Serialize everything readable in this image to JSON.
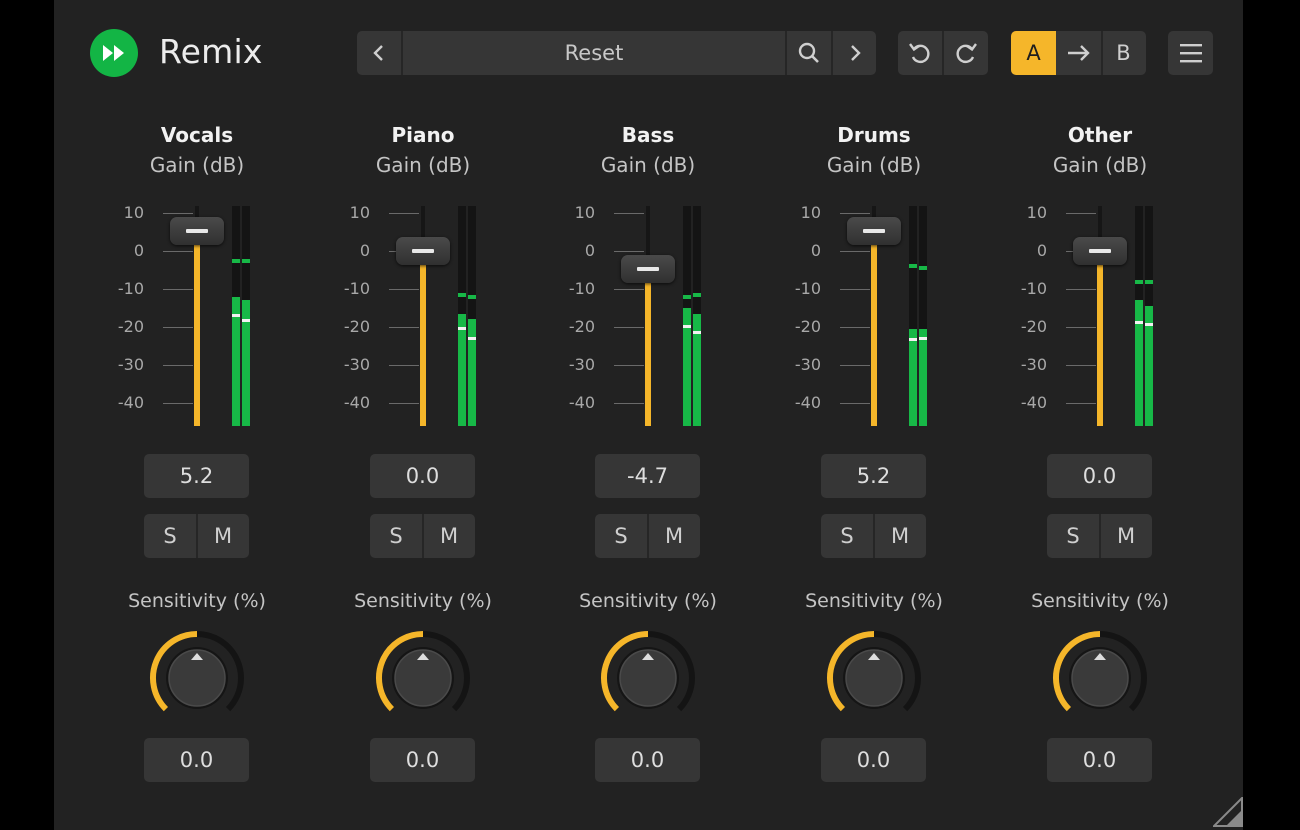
{
  "app": {
    "title": "Remix",
    "logo_icon": "fast-forward-icon",
    "accent": "#f5b62a",
    "logo_color": "#13b545",
    "meter_color": "#17b847"
  },
  "toolbar": {
    "prev_icon": "chevron-left-icon",
    "preset_name": "Reset",
    "search_icon": "search-icon",
    "next_icon": "chevron-right-icon",
    "undo_icon": "undo-icon",
    "redo_icon": "redo-icon",
    "ab_a_label": "A",
    "ab_copy_icon": "arrow-right-icon",
    "ab_b_label": "B",
    "menu_icon": "hamburger-menu-icon"
  },
  "scale_ticks": [
    "10",
    "0",
    "-10",
    "-20",
    "-30",
    "-40"
  ],
  "gain_label": "Gain (dB)",
  "sensitivity_label": "Sensitivity (%)",
  "solo_label": "S",
  "mute_label": "M",
  "channels": [
    {
      "name": "Vocals",
      "gain": "5.2",
      "gain_value": 5.2,
      "sensitivity": "0.0",
      "sensitivity_value": 0.0,
      "meter_left": {
        "peak": -2,
        "level": -12,
        "rms": -16.5
      },
      "meter_right": {
        "peak": -2,
        "level": -13,
        "rms": -18
      }
    },
    {
      "name": "Piano",
      "gain": "0.0",
      "gain_value": 0.0,
      "sensitivity": "0.0",
      "sensitivity_value": 0.0,
      "meter_left": {
        "peak": -11,
        "level": -16.5,
        "rms": -20
      },
      "meter_right": {
        "peak": -11.5,
        "level": -18,
        "rms": -22.5
      }
    },
    {
      "name": "Bass",
      "gain": "-4.7",
      "gain_value": -4.7,
      "sensitivity": "0.0",
      "sensitivity_value": 0.0,
      "meter_left": {
        "peak": -11.5,
        "level": -15,
        "rms": -19.5
      },
      "meter_right": {
        "peak": -11,
        "level": -16.5,
        "rms": -21
      }
    },
    {
      "name": "Drums",
      "gain": "5.2",
      "gain_value": 5.2,
      "sensitivity": "0.0",
      "sensitivity_value": 0.0,
      "meter_left": {
        "peak": -3.5,
        "level": -20.5,
        "rms": -23
      },
      "meter_right": {
        "peak": -4,
        "level": -20.5,
        "rms": -22.5
      }
    },
    {
      "name": "Other",
      "gain": "0.0",
      "gain_value": 0.0,
      "sensitivity": "0.0",
      "sensitivity_value": 0.0,
      "meter_left": {
        "peak": -7.5,
        "level": -13,
        "rms": -18.5
      },
      "meter_right": {
        "peak": -7.5,
        "level": -14.5,
        "rms": -19
      }
    }
  ],
  "resize_icon": "resize-grip-icon"
}
